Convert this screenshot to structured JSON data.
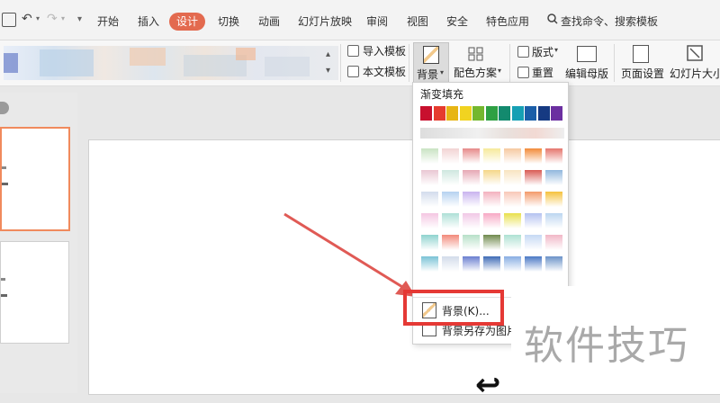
{
  "menubar": {
    "tabs": [
      {
        "id": "start",
        "label": "开始"
      },
      {
        "id": "insert",
        "label": "插入"
      },
      {
        "id": "design",
        "label": "设计"
      },
      {
        "id": "transition",
        "label": "切换"
      },
      {
        "id": "animation",
        "label": "动画"
      },
      {
        "id": "slideshow",
        "label": "幻灯片放映"
      },
      {
        "id": "review",
        "label": "审阅"
      },
      {
        "id": "view",
        "label": "视图"
      },
      {
        "id": "security",
        "label": "安全"
      },
      {
        "id": "features",
        "label": "特色应用"
      }
    ],
    "search_label": "查找命令、搜索模板"
  },
  "ribbon": {
    "import_template": "导入模板",
    "this_template": "本文模板",
    "background": "背景",
    "color_scheme": "配色方案",
    "layout": "版式",
    "reset": "重置",
    "edit_master": "编辑母版",
    "page_setup": "页面设置",
    "slide_size": "幻灯片大小"
  },
  "dropdown": {
    "gradient_label": "渐变填充",
    "background_item": "背景(K)...",
    "save_background_item": "背景另存为图片"
  },
  "watermark": {
    "text": "软件技巧"
  },
  "colors": {
    "accent": "#e36a4f",
    "highlight_box": "#e53935",
    "arrow": "#e05a55",
    "solid_swatches": [
      "#c8102e",
      "#e63b2e",
      "#e7b514",
      "#f1d320",
      "#74b72e",
      "#2ea043",
      "#138a6e",
      "#16a0b4",
      "#1b5ea8",
      "#163a82",
      "#6b2fa0"
    ],
    "gradient_swatches": [
      [
        "#c9e3c3",
        "#f2d3d3",
        "#e68a8a",
        "#f6e99a",
        "#f6c9a0",
        "#f28b3a",
        "#e5766d"
      ],
      [
        "#e9c7d3",
        "#cfe7df",
        "#e6a7b4",
        "#f5d789",
        "#f8e4c1",
        "#d95b54",
        "#91b7dd"
      ],
      [
        "#d3dcec",
        "#b5d2f0",
        "#c9b3ee",
        "#f3b1bf",
        "#f8c8b8",
        "#f39a6a",
        "#f5c23d"
      ],
      [
        "#f4c6e2",
        "#aee0d7",
        "#f1c8e6",
        "#f7a9c5",
        "#e8e04c",
        "#b4c2f0",
        "#bcd6f0"
      ],
      [
        "#8fd3cf",
        "#f28a7b",
        "#b7e0c8",
        "#708a4e",
        "#aee1d3",
        "#c6d9f4",
        "#f1b7c7"
      ],
      [
        "#7ac3d6",
        "#d3dcea",
        "#6a7fd0",
        "#3f6bb6",
        "#89aee3",
        "#4b79c5",
        "#6b93c8"
      ]
    ]
  }
}
